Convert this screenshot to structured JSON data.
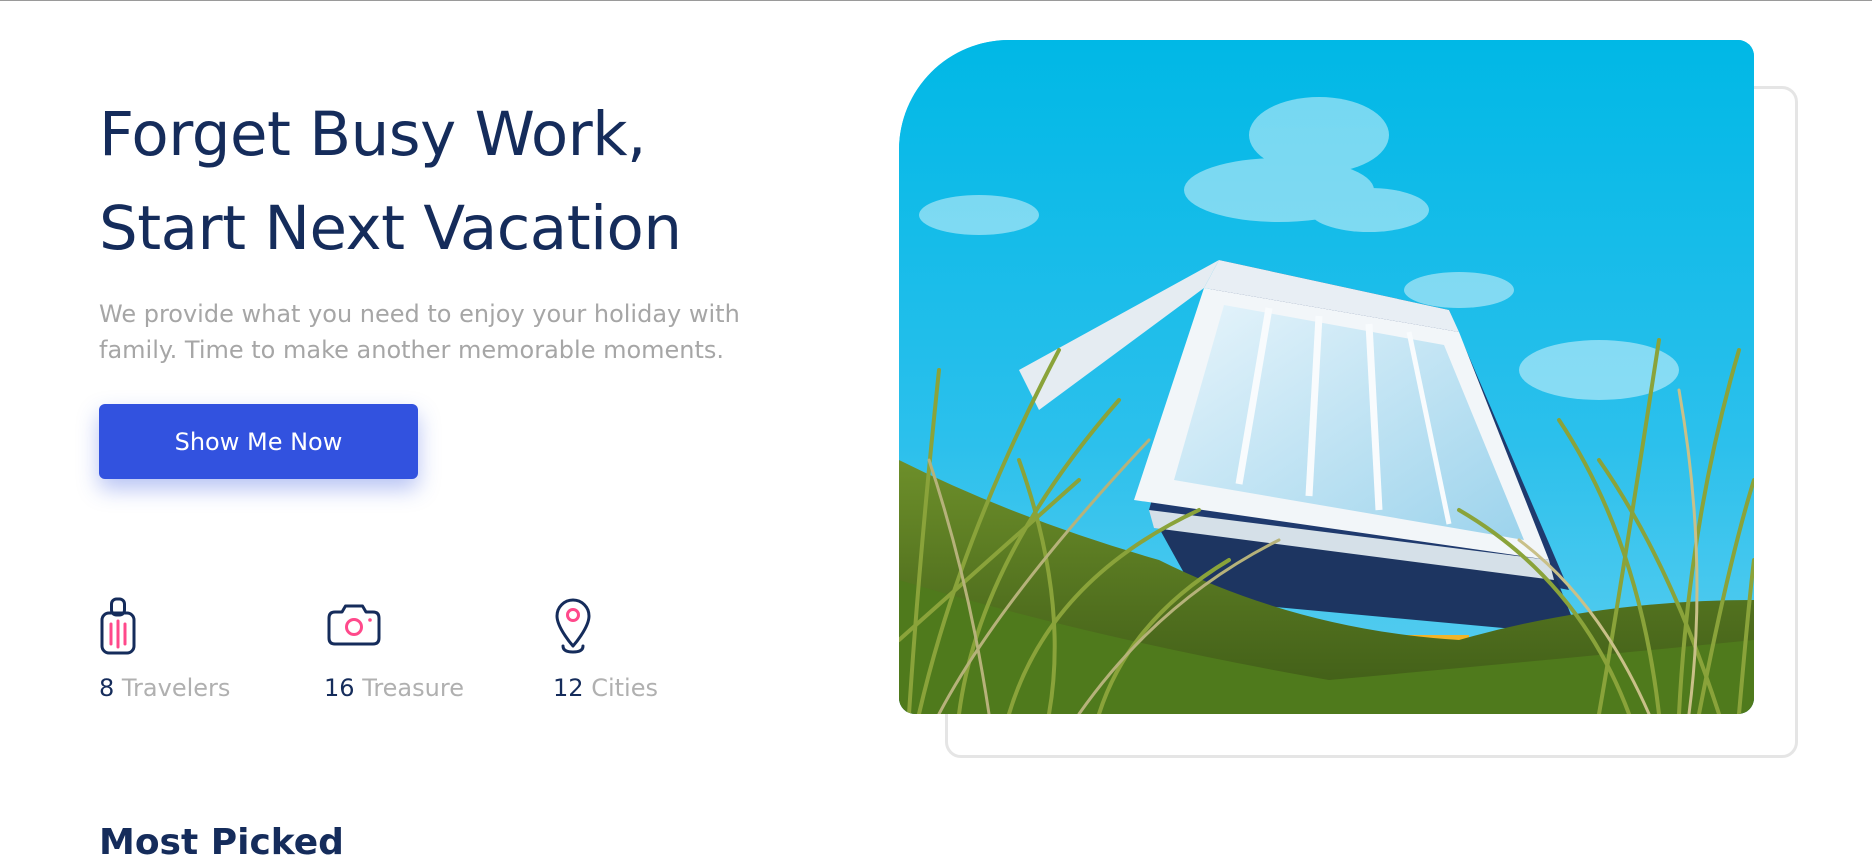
{
  "hero": {
    "title_line1": "Forget Busy Work,",
    "title_line2": "Start Next Vacation",
    "subtitle_line1": "We provide what you need to enjoy your holiday with",
    "subtitle_line2": "family. Time to make another memorable moments.",
    "cta_label": "Show Me Now",
    "image_alt": "Glass-walled cabin on a grassy hill under blue sky"
  },
  "stats": [
    {
      "icon": "suitcase-icon",
      "number": "8",
      "label": "Travelers"
    },
    {
      "icon": "camera-icon",
      "number": "16",
      "label": "Treasure"
    },
    {
      "icon": "map-pin-icon",
      "number": "12",
      "label": "Cities"
    }
  ],
  "section": {
    "title": "Most Picked"
  },
  "colors": {
    "primary_text": "#152c5b",
    "muted_text": "#b0b0b0",
    "accent": "#3252df",
    "icon_accent": "#ff498b"
  }
}
